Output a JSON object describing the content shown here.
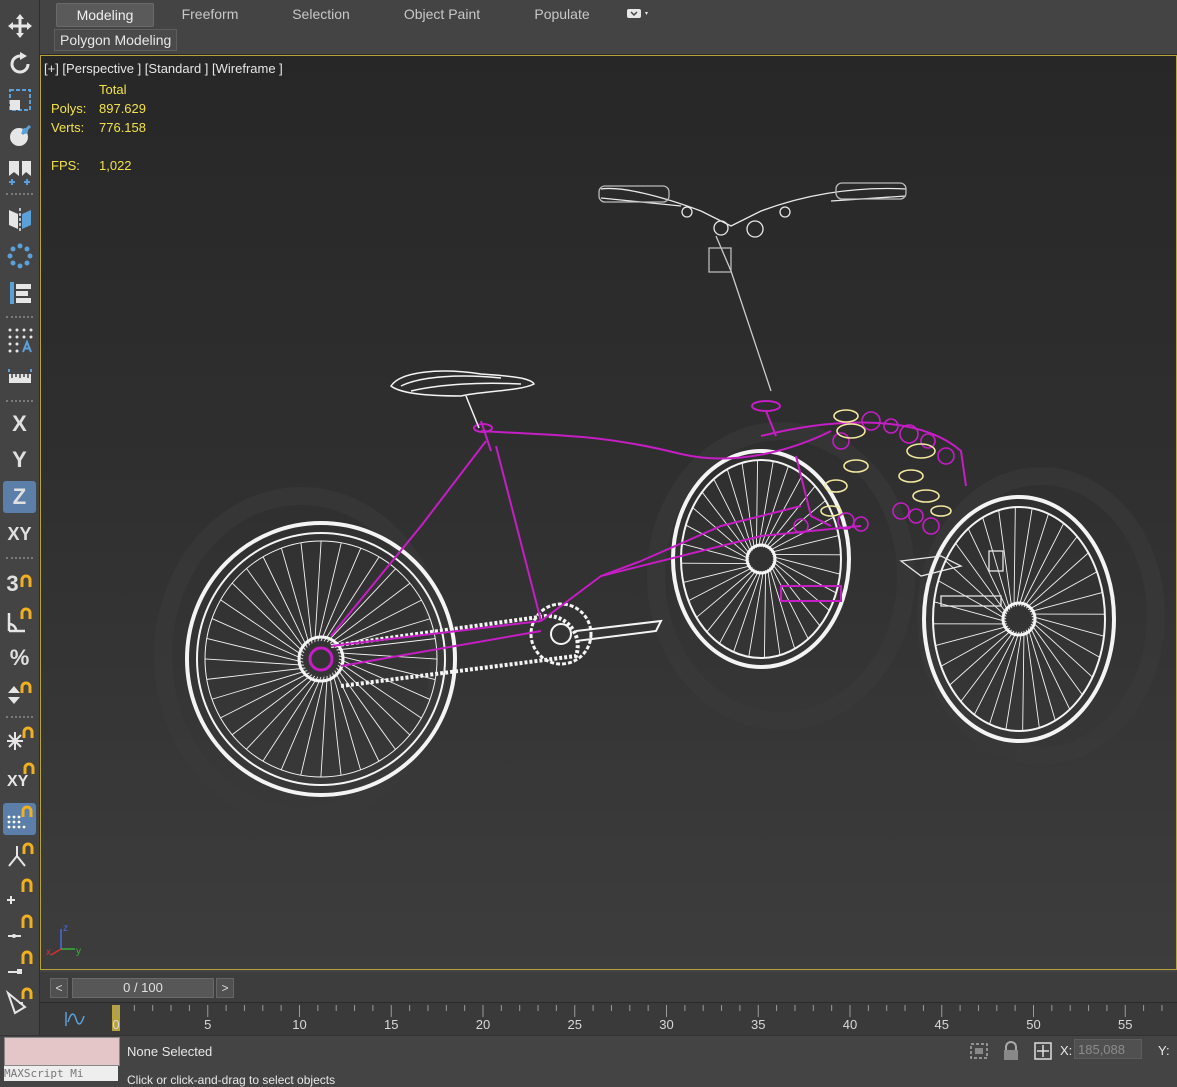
{
  "ribbon": {
    "tabs": [
      {
        "label": "Modeling",
        "active": true
      },
      {
        "label": "Freeform",
        "active": false
      },
      {
        "label": "Selection",
        "active": false
      },
      {
        "label": "Object Paint",
        "active": false
      },
      {
        "label": "Populate",
        "active": false
      }
    ],
    "panel_label": "Polygon Modeling"
  },
  "toolbar": {
    "x_label": "X",
    "y_label": "Y",
    "z_label": "Z",
    "xy_label": "XY",
    "snap3_label": "3",
    "percent_label": "%"
  },
  "viewport": {
    "label": "[+] [Perspective ] [Standard ] [Wireframe ]",
    "stats": {
      "total_label": "Total",
      "polys_label": "Polys:",
      "polys_value": "897.629",
      "verts_label": "Verts:",
      "verts_value": "776.158",
      "fps_label": "FPS:",
      "fps_value": "1,022"
    },
    "axis": {
      "x": "x",
      "y": "y",
      "z": "z"
    }
  },
  "timeslider": {
    "prev": "<",
    "next": ">",
    "frame": "0 / 100"
  },
  "trackbar": {
    "ticks": [
      "0",
      "5",
      "10",
      "15",
      "20",
      "25",
      "30",
      "35",
      "40",
      "45",
      "50",
      "55"
    ]
  },
  "status": {
    "maxscript_mini": "MAXScript Mi",
    "selection": "None Selected",
    "prompt": "Click or click-and-drag to select objects",
    "x_label": "X:",
    "x_value": "185,088",
    "y_label": "Y:"
  },
  "colors": {
    "accent": "#5b7fa8",
    "viewport_border": "#b8a23a",
    "stats_text": "#f2e24a",
    "wire_white": "#ffffff",
    "wire_magenta": "#c41ec4",
    "wire_yellow": "#f2e8a0"
  }
}
